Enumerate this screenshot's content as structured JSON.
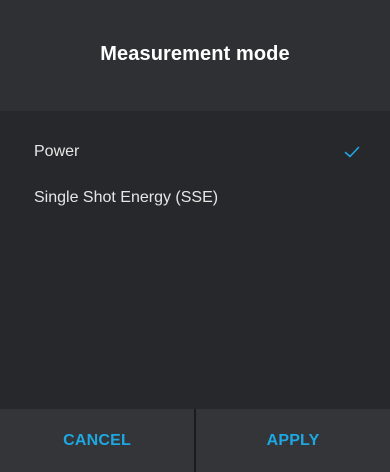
{
  "dialog": {
    "title": "Measurement mode",
    "options": [
      {
        "label": "Power",
        "selected": true
      },
      {
        "label": "Single Shot Energy (SSE)",
        "selected": false
      }
    ],
    "cancel_label": "CANCEL",
    "apply_label": "APPLY"
  },
  "colors": {
    "accent": "#1ea7e1",
    "background": "#2a2c2f"
  },
  "icons": {
    "selected": "checkmark-icon"
  }
}
